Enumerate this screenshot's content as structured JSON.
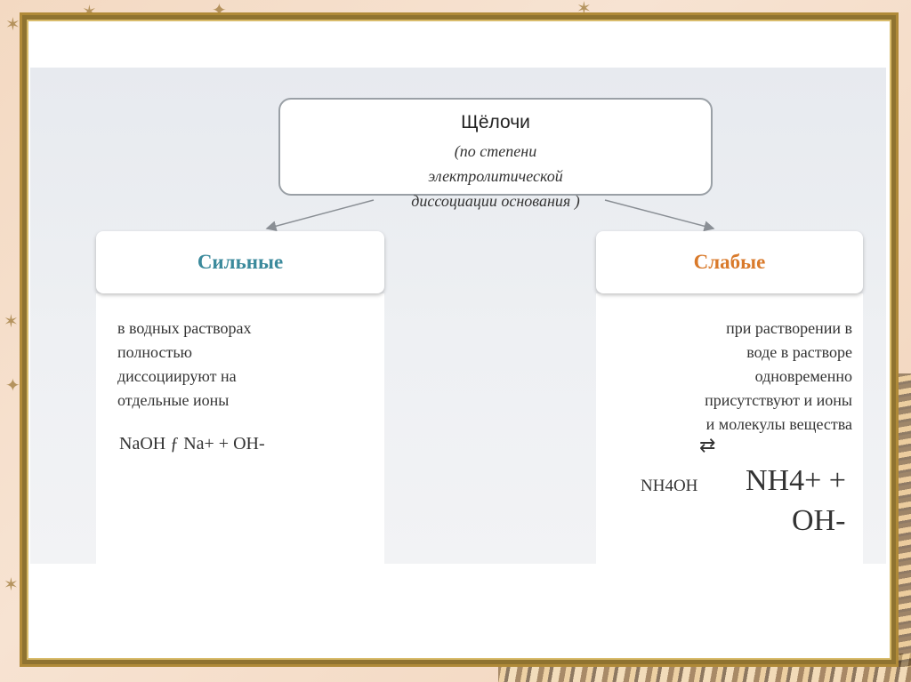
{
  "diagram": {
    "top": {
      "title": "Щёлочи",
      "subtitle_lines": [
        "(по степени",
        "электролитической",
        "диссоциации основания )"
      ]
    },
    "left": {
      "header": "Сильные",
      "header_color": "#3b8a9c",
      "description_lines": [
        "в водных растворах",
        "полностью",
        "диссоциируют  на",
        "отдельные ионы"
      ],
      "formula": "NaOH ƒ  Na+ + OH-"
    },
    "right": {
      "header": "Слабые",
      "header_color": "#d97a2b",
      "description_lines": [
        "при растворении в",
        "воде  в растворе",
        "одновременно",
        "присутствуют и ионы",
        "и молекулы вещества"
      ],
      "equilibrium_symbol": "⇄",
      "formula_reactant": "NH4OH",
      "formula_product_1": "NH4+ +",
      "formula_product_2": "OH-"
    }
  }
}
